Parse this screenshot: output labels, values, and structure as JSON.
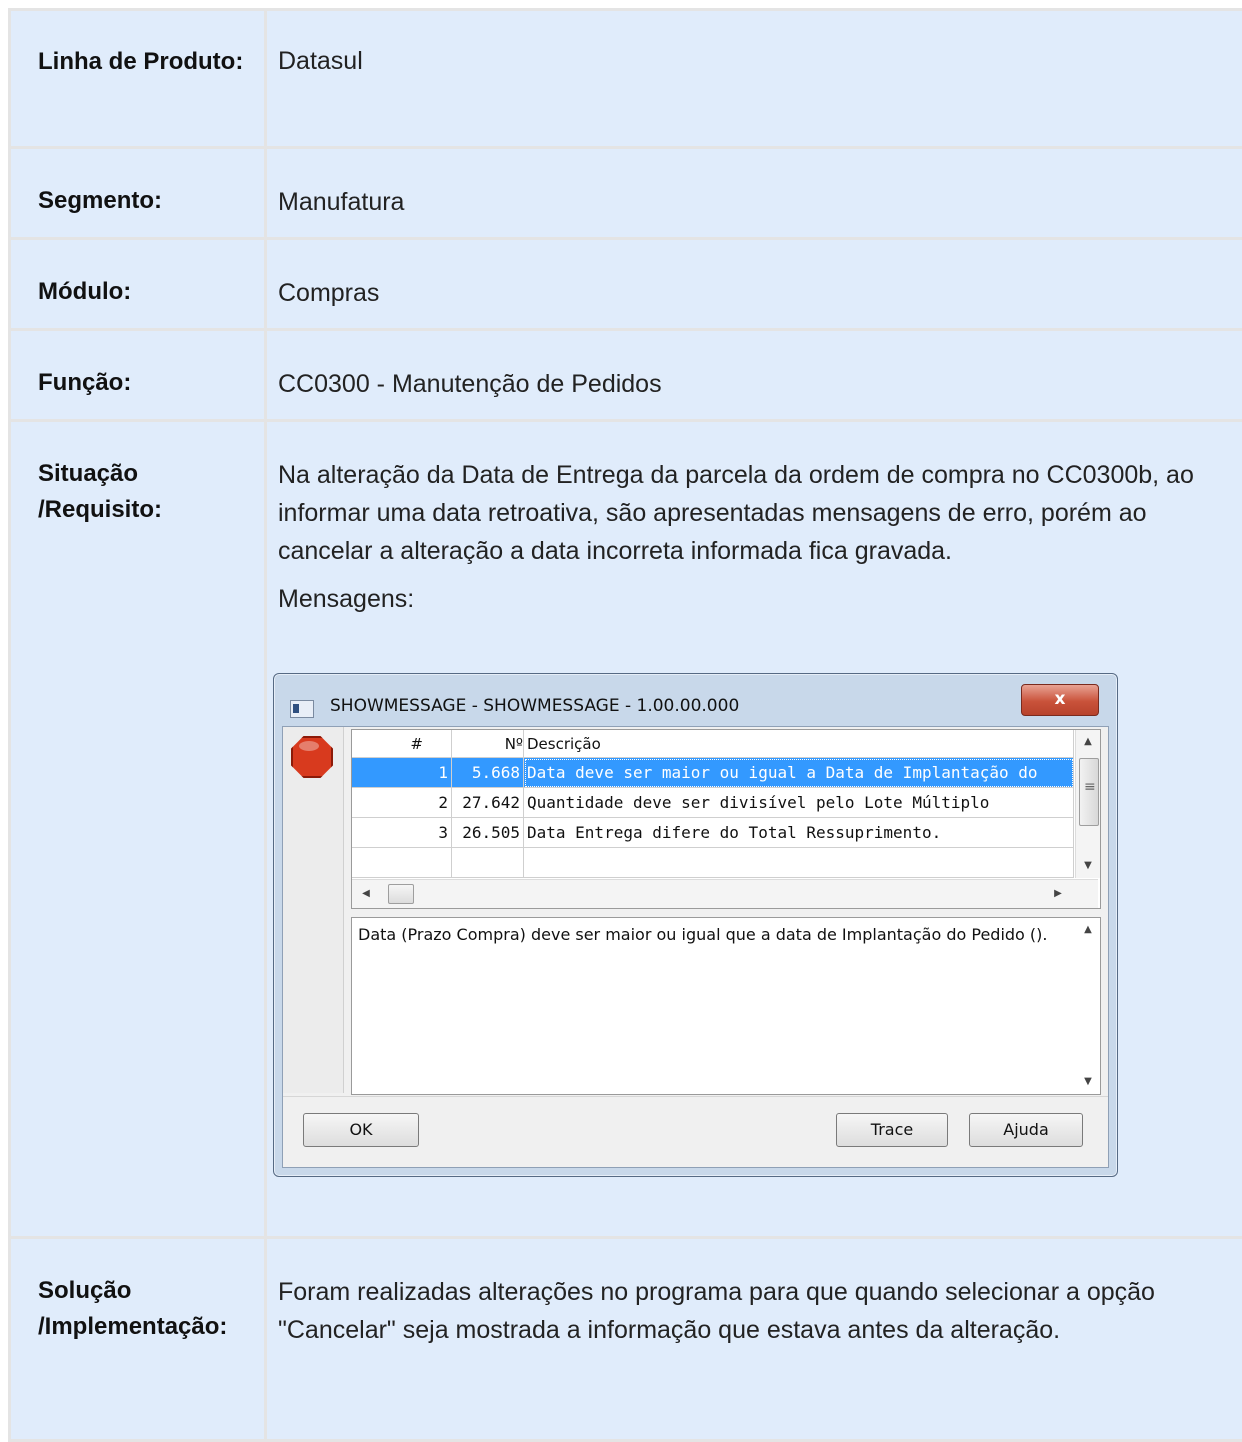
{
  "rows": [
    {
      "label": "Linha de Produto:",
      "value": "Datasul"
    },
    {
      "label": "Segmento:",
      "value": "Manufatura"
    },
    {
      "label": "Módulo:",
      "value": "Compras"
    },
    {
      "label": "Função:",
      "value": "CC0300 - Manutenção de Pedidos"
    }
  ],
  "situacao": {
    "label": "Situação /Requisito:",
    "text": "Na alteração da Data de Entrega da parcela da ordem de compra no CC0300b, ao informar uma data retroativa, são apresentadas mensagens de erro, porém ao cancelar a alteração a data incorreta informada fica gravada.",
    "mensagens_label": "Mensagens:"
  },
  "dialog": {
    "title": "SHOWMESSAGE - SHOWMESSAGE - 1.00.00.000",
    "close_label": "x",
    "icon": "stop-icon",
    "columns": [
      "#",
      "Nº",
      "Descrição"
    ],
    "messages": [
      {
        "index": "1",
        "number": "5.668",
        "description": "Data deve ser maior ou igual a Data de Implantação do",
        "selected": true
      },
      {
        "index": "2",
        "number": "27.642",
        "description": "Quantidade deve ser divisível pelo Lote Múltiplo",
        "selected": false
      },
      {
        "index": "3",
        "number": "26.505",
        "description": "Data Entrega difere do Total Ressuprimento.",
        "selected": false
      }
    ],
    "detail_text": "Data (Prazo Compra) deve ser maior ou igual que a data de Implantação do Pedido ().",
    "buttons": {
      "ok": "OK",
      "trace": "Trace",
      "ajuda": "Ajuda"
    }
  },
  "solucao": {
    "label": "Solução /Implementação:",
    "text": "Foram realizadas alterações no programa para que quando selecionar a opção \"Cancelar\" seja mostrada a informação que estava antes da alteração."
  }
}
